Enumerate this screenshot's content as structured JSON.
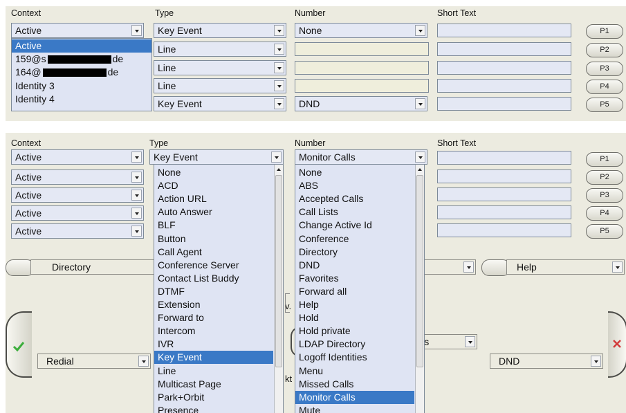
{
  "headers": {
    "context": "Context",
    "type": "Type",
    "number": "Number",
    "short_text": "Short Text"
  },
  "top": {
    "rows": [
      {
        "context": "Active",
        "type": "Key Event",
        "number": "None",
        "p": "P1"
      },
      {
        "context": "",
        "type": "Line",
        "number": "",
        "p": "P2"
      },
      {
        "context": "",
        "type": "Line",
        "number": "",
        "p": "P3"
      },
      {
        "context": "",
        "type": "Line",
        "number": "",
        "p": "P4"
      },
      {
        "context": "",
        "type": "Key Event",
        "number": "DND",
        "p": "P5"
      }
    ],
    "context_options": [
      {
        "label": "Active",
        "selected": true
      },
      {
        "pre": "159@s",
        "post": "de"
      },
      {
        "pre": "164@",
        "post": "de"
      },
      {
        "label": "Identity 3"
      },
      {
        "label": "Identity 4"
      }
    ]
  },
  "bottom": {
    "rows": [
      {
        "context": "Active",
        "type": "Key Event",
        "number": "Monitor Calls",
        "p": "P1"
      },
      {
        "context": "Active",
        "p": "P2"
      },
      {
        "context": "Active",
        "p": "P3"
      },
      {
        "context": "Active",
        "p": "P4"
      },
      {
        "context": "Active",
        "p": "P5"
      }
    ],
    "type_options": [
      "None",
      "ACD",
      "Action URL",
      "Auto Answer",
      "BLF",
      "Button",
      "Call Agent",
      "Conference Server",
      "Contact List Buddy",
      "DTMF",
      "Extension",
      "Forward to",
      "Intercom",
      "IVR",
      "Key Event",
      "Line",
      "Multicast Page",
      "Park+Orbit",
      "Presence"
    ],
    "type_selected_index": 14,
    "number_options": [
      "None",
      "ABS",
      "Accepted Calls",
      "Call Lists",
      "Change Active Id",
      "Conference",
      "Directory",
      "DND",
      "Favorites",
      "Forward all",
      "Help",
      "Hold",
      "Hold private",
      "LDAP Directory",
      "Logoff Identities",
      "Menu",
      "Missed Calls",
      "Monitor Calls",
      "Mute"
    ],
    "number_selected_index": 17,
    "directory_label": "Directory",
    "help_label": "Help",
    "redial_label": "Redial",
    "dnd_label": "DND",
    "partial_calls": "lls",
    "partial_v": "v.",
    "partial_kt": "kt"
  },
  "colors": {
    "panel": "#ecebe0",
    "selection": "#3a79c6",
    "field": "#e4e8f4",
    "ok_green": "#3cae3c",
    "cancel_red": "#d23a3a"
  }
}
